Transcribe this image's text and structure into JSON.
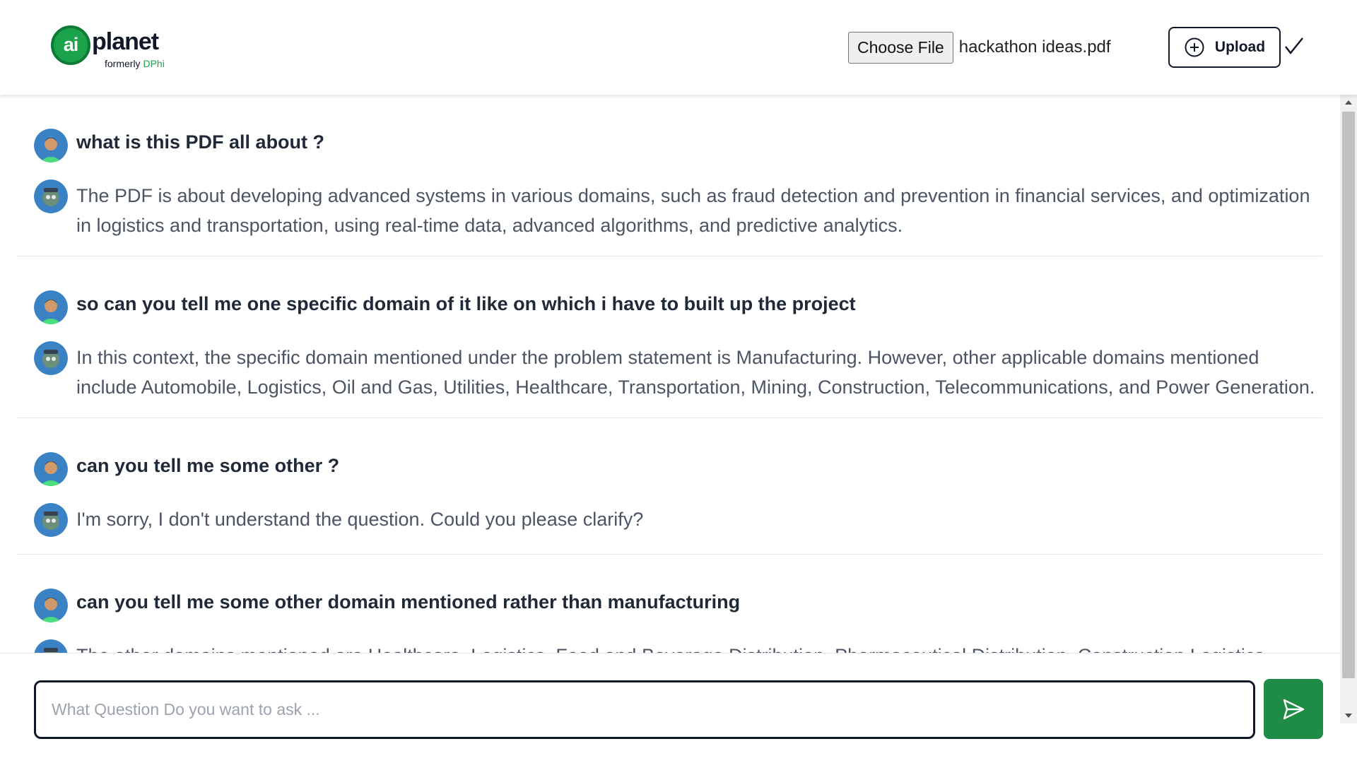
{
  "header": {
    "logo": {
      "mark": "ai",
      "word": "planet",
      "sub_prefix": "formerly",
      "sub_brand": "DPhi"
    },
    "choose_file_label": "Choose File",
    "file_name": "hackathon ideas.pdf",
    "upload_label": "Upload",
    "icons": {
      "upload": "plus-circle-icon",
      "status": "check-icon"
    }
  },
  "chat": {
    "exchanges": [
      {
        "question": "what is this PDF all about ?",
        "answer": "The PDF is about developing advanced systems in various domains, such as fraud detection and prevention in financial services, and optimization in logistics and transportation, using real-time data, advanced algorithms, and predictive analytics."
      },
      {
        "question": "so can you tell me one specific domain of it like on which i have to built up the project",
        "answer": "In this context, the specific domain mentioned under the problem statement is Manufacturing. However, other applicable domains mentioned include Automobile, Logistics, Oil and Gas, Utilities, Healthcare, Transportation, Mining, Construction, Telecommunications, and Power Generation."
      },
      {
        "question": "can you tell me some other ?",
        "answer": "I'm sorry, I don't understand the question. Could you please clarify?"
      },
      {
        "question": "can you tell me some other domain mentioned rather than manufacturing",
        "answer": "The other domains mentioned are Healthcare, Logistics, Food and Beverage Distribution, Pharmaceutical Distribution, Construction Logistics,"
      }
    ]
  },
  "input": {
    "placeholder": "What Question Do you want to ask ...",
    "value": ""
  },
  "colors": {
    "brand_green": "#1aa34a",
    "send_button": "#1e8c46",
    "question_text": "#1f2937",
    "answer_text": "#4b5563"
  }
}
